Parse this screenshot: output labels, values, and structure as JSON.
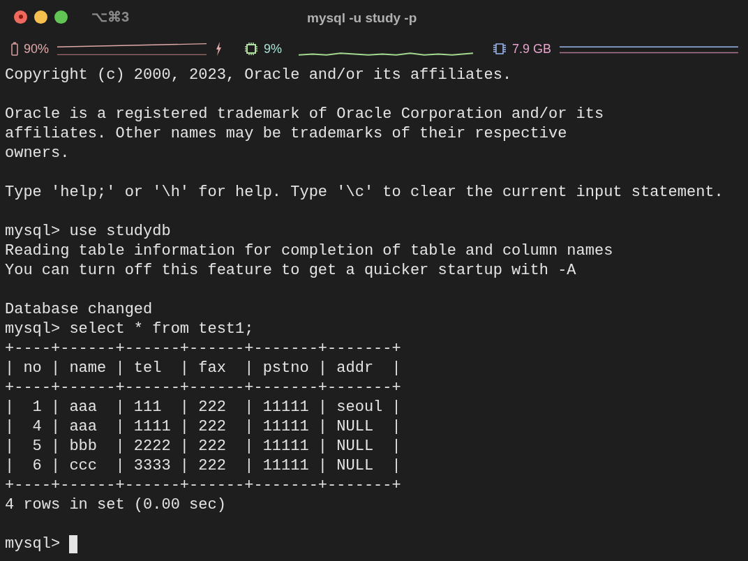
{
  "window": {
    "title": "mysql -u study -p",
    "shortcut": "⌥⌘3"
  },
  "status_bar": {
    "battery": "90%",
    "cpu": "9%",
    "memory": "7.9 GB"
  },
  "blocks": [
    [
      "Copyright (c) 2000, 2023, Oracle and/or its affiliates."
    ],
    [
      "Oracle is a registered trademark of Oracle Corporation and/or its",
      "affiliates. Other names may be trademarks of their respective",
      "owners."
    ],
    [
      "Type 'help;' or '\\h' for help. Type '\\c' to clear the current input statement."
    ],
    [
      "mysql> use studydb",
      "Reading table information for completion of table and column names",
      "You can turn off this feature to get a quicker startup with -A"
    ],
    [
      "Database changed",
      "mysql> select * from test1;",
      "+----+------+------+------+-------+-------+",
      "| no | name | tel  | fax  | pstno | addr  |",
      "+----+------+------+------+-------+-------+",
      "|  1 | aaa  | 111  | 222  | 11111 | seoul |",
      "|  4 | aaa  | 1111 | 222  | 11111 | NULL  |",
      "|  5 | bbb  | 2222 | 222  | 11111 | NULL  |",
      "|  6 | ccc  | 3333 | 222  | 11111 | NULL  |",
      "+----+------+------+------+-------+-------+",
      "4 rows in set (0.00 sec)"
    ]
  ],
  "prompt": "mysql>"
}
